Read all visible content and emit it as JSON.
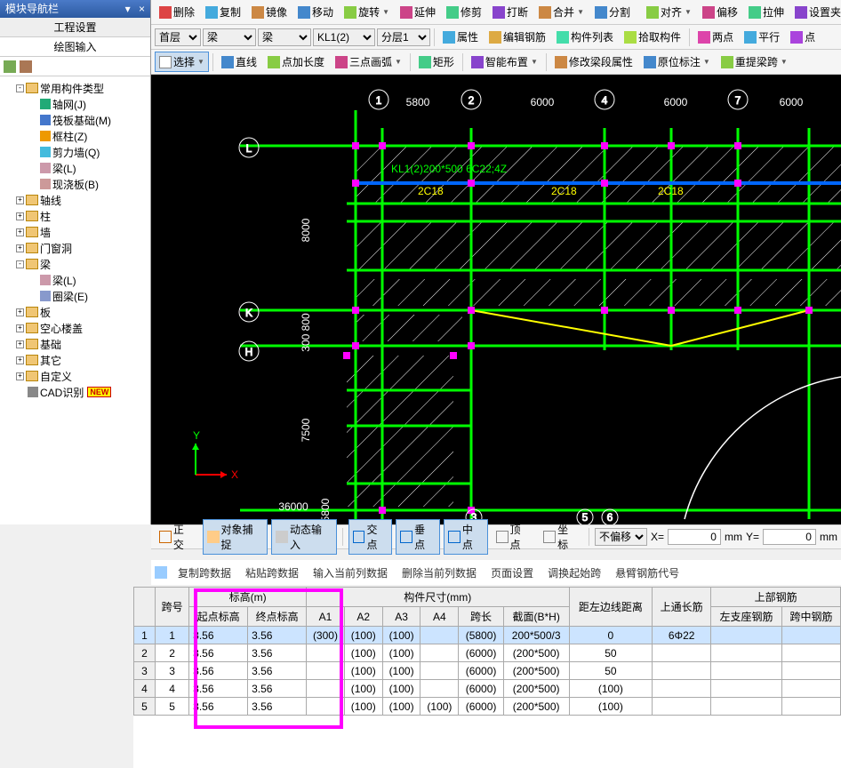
{
  "panel": {
    "title": "模块导航栏",
    "pin_icon": "▾",
    "close_icon": "×",
    "tab1": "工程设置",
    "tab2": "绘图输入"
  },
  "tree": [
    {
      "indent": 1,
      "expand": "-",
      "icon": "folder",
      "label": "常用构件类型"
    },
    {
      "indent": 2,
      "icon": "grid",
      "label": "轴网(J)",
      "color": "#2a7"
    },
    {
      "indent": 2,
      "icon": "grid",
      "label": "筏板基础(M)",
      "color": "#47c"
    },
    {
      "indent": 2,
      "icon": "col",
      "label": "框柱(Z)",
      "color": "#e90"
    },
    {
      "indent": 2,
      "icon": "wall",
      "label": "剪力墙(Q)",
      "color": "#4bd"
    },
    {
      "indent": 2,
      "icon": "beam",
      "label": "梁(L)",
      "color": "#c9a"
    },
    {
      "indent": 2,
      "icon": "slab",
      "label": "现浇板(B)",
      "color": "#c99"
    },
    {
      "indent": 1,
      "expand": "+",
      "icon": "folder",
      "label": "轴线"
    },
    {
      "indent": 1,
      "expand": "+",
      "icon": "folder",
      "label": "柱"
    },
    {
      "indent": 1,
      "expand": "+",
      "icon": "folder",
      "label": "墙"
    },
    {
      "indent": 1,
      "expand": "+",
      "icon": "folder",
      "label": "门窗洞"
    },
    {
      "indent": 1,
      "expand": "-",
      "icon": "folder",
      "label": "梁"
    },
    {
      "indent": 2,
      "icon": "beam",
      "label": "梁(L)",
      "color": "#c9a"
    },
    {
      "indent": 2,
      "icon": "beam",
      "label": "圈梁(E)",
      "color": "#89c"
    },
    {
      "indent": 1,
      "expand": "+",
      "icon": "folder",
      "label": "板"
    },
    {
      "indent": 1,
      "expand": "+",
      "icon": "folder",
      "label": "空心楼盖"
    },
    {
      "indent": 1,
      "expand": "+",
      "icon": "folder",
      "label": "基础"
    },
    {
      "indent": 1,
      "expand": "+",
      "icon": "folder",
      "label": "其它"
    },
    {
      "indent": 1,
      "expand": "+",
      "icon": "folder",
      "label": "自定义"
    },
    {
      "indent": 1,
      "icon": "cad",
      "label": "CAD识别",
      "badge": "NEW"
    }
  ],
  "toolbar1": {
    "delete": "删除",
    "copy": "复制",
    "mirror": "镜像",
    "move": "移动",
    "rotate": "旋转",
    "extend": "延伸",
    "trim": "修剪",
    "break": "打断",
    "merge": "合并",
    "split": "分割",
    "align": "对齐",
    "offset": "偏移",
    "drag": "拉伸",
    "setclip": "设置夹"
  },
  "toolbar2": {
    "floor_label": "首层",
    "cat1": "梁",
    "cat2": "梁",
    "member": "KL1(2)",
    "sub": "分层1",
    "props": "属性",
    "editbar": "编辑钢筋",
    "list": "构件列表",
    "pick": "拾取构件",
    "twopoint": "两点",
    "parallel": "平行",
    "point": "点"
  },
  "toolbar3": {
    "select": "选择",
    "line": "直线",
    "pointlen": "点加长度",
    "arc3": "三点画弧",
    "rect": "矩形",
    "smart": "智能布置",
    "editseg": "修改梁段属性",
    "origmark": "原位标注",
    "respan": "重提梁跨"
  },
  "canvas": {
    "cols": [
      {
        "num": "1",
        "pos": 430
      },
      {
        "num": "2",
        "pos": 530
      },
      {
        "num": "4",
        "pos": 680
      },
      {
        "num": "7",
        "pos": 830
      }
    ],
    "col_dims": [
      "5800",
      "6000",
      "6000",
      "6000"
    ],
    "rows": [
      {
        "label": "L",
        "pos": 170
      },
      {
        "label": "K",
        "pos": 350
      },
      {
        "label": "H",
        "pos": 398
      }
    ],
    "row_dims": [
      "8000",
      "300 800",
      "7500",
      "36000",
      "5800"
    ],
    "beam_label": "KL1(2)200*500  6C22;4Z",
    "beam_tag1": "2C18",
    "beam_tag2": "2C18",
    "beam_tag3": "2C18",
    "circles": [
      {
        "num": "3"
      },
      {
        "num": "5"
      },
      {
        "num": "6"
      }
    ]
  },
  "status": {
    "ortho": "正交",
    "osnap": "对象捕捉",
    "dyn": "动态输入",
    "cross": "交点",
    "perp": "垂点",
    "mid": "中点",
    "apex": "顶点",
    "coord": "坐标",
    "nooffset": "不偏移",
    "x_val": "0",
    "y_val": "0",
    "unit": "mm",
    "xlabel": "X=",
    "ylabel": "Y="
  },
  "grid_toolbar": {
    "copyspan": "复制跨数据",
    "pastespan": "粘贴跨数据",
    "inputcol": "输入当前列数据",
    "delcol": "删除当前列数据",
    "pageset": "页面设置",
    "swapstart": "调换起始跨",
    "cantcode": "悬臂钢筋代号"
  },
  "grid": {
    "headers": {
      "span_no": "跨号",
      "elev": "标高(m)",
      "start_elev": "起点标高",
      "end_elev": "终点标高",
      "member_dim": "构件尺寸(mm)",
      "A1": "A1",
      "A2": "A2",
      "A3": "A3",
      "A4": "A4",
      "span": "跨长",
      "section": "截面(B*H)",
      "edge_dist": "距左边线距离",
      "top_long": "上通长筋",
      "upper": "上部钢筋",
      "left_sup": "左支座钢筋",
      "mid_span": "跨中钢筋"
    },
    "rows": [
      {
        "n": "1",
        "jn": "1",
        "se": "3.56",
        "ee": "3.56",
        "a1": "(300)",
        "a2": "(100)",
        "a3": "(100)",
        "a4": "",
        "span": "(5800)",
        "sec": "200*500/3",
        "dist": "0",
        "top": "6Φ22"
      },
      {
        "n": "2",
        "jn": "2",
        "se": "3.56",
        "ee": "3.56",
        "a1": "",
        "a2": "(100)",
        "a3": "(100)",
        "a4": "",
        "span": "(6000)",
        "sec": "(200*500)",
        "dist": "50",
        "top": ""
      },
      {
        "n": "3",
        "jn": "3",
        "se": "3.56",
        "ee": "3.56",
        "a1": "",
        "a2": "(100)",
        "a3": "(100)",
        "a4": "",
        "span": "(6000)",
        "sec": "(200*500)",
        "dist": "50",
        "top": ""
      },
      {
        "n": "4",
        "jn": "4",
        "se": "3.56",
        "ee": "3.56",
        "a1": "",
        "a2": "(100)",
        "a3": "(100)",
        "a4": "",
        "span": "(6000)",
        "sec": "(200*500)",
        "dist": "(100)",
        "top": ""
      },
      {
        "n": "5",
        "jn": "5",
        "se": "3.56",
        "ee": "3.56",
        "a1": "",
        "a2": "(100)",
        "a3": "(100)",
        "a4": "(100)",
        "span": "(6000)",
        "sec": "(200*500)",
        "dist": "(100)",
        "top": ""
      }
    ]
  }
}
